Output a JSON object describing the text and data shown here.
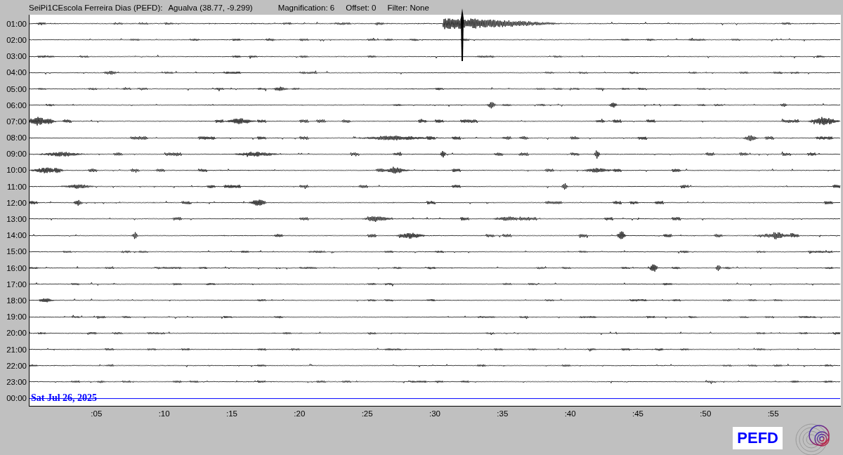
{
  "header": {
    "station": "SeiPi1CEscola Ferreira Dias (PEFD):",
    "location": "Agualva (38.77, -9.299)",
    "magnification": "Magnification: 6",
    "offset": "Offset: 0",
    "filter": "Filter: None"
  },
  "rows": [
    {
      "time": "01:00",
      "kind": "trace"
    },
    {
      "time": "02:00",
      "kind": "trace"
    },
    {
      "time": "03:00",
      "kind": "trace"
    },
    {
      "time": "04:00",
      "kind": "trace"
    },
    {
      "time": "05:00",
      "kind": "trace"
    },
    {
      "time": "06:00",
      "kind": "trace"
    },
    {
      "time": "07:00",
      "kind": "trace"
    },
    {
      "time": "08:00",
      "kind": "trace"
    },
    {
      "time": "09:00",
      "kind": "trace"
    },
    {
      "time": "10:00",
      "kind": "trace"
    },
    {
      "time": "11:00",
      "kind": "trace"
    },
    {
      "time": "12:00",
      "kind": "trace"
    },
    {
      "time": "13:00",
      "kind": "trace"
    },
    {
      "time": "14:00",
      "kind": "trace"
    },
    {
      "time": "15:00",
      "kind": "trace"
    },
    {
      "time": "16:00",
      "kind": "trace"
    },
    {
      "time": "17:00",
      "kind": "trace"
    },
    {
      "time": "18:00",
      "kind": "trace"
    },
    {
      "time": "19:00",
      "kind": "trace"
    },
    {
      "time": "20:00",
      "kind": "trace"
    },
    {
      "time": "21:00",
      "kind": "trace"
    },
    {
      "time": "22:00",
      "kind": "trace"
    },
    {
      "time": "23:00",
      "kind": "trace"
    },
    {
      "time": "00:00",
      "kind": "pending"
    }
  ],
  "date": "Sat Jul 26, 2025",
  "minute_ticks": [
    ":05",
    ":10",
    ":15",
    ":20",
    ":25",
    ":30",
    ":35",
    ":40",
    ":45",
    ":50",
    ":55"
  ],
  "station_code": "PEFD"
}
